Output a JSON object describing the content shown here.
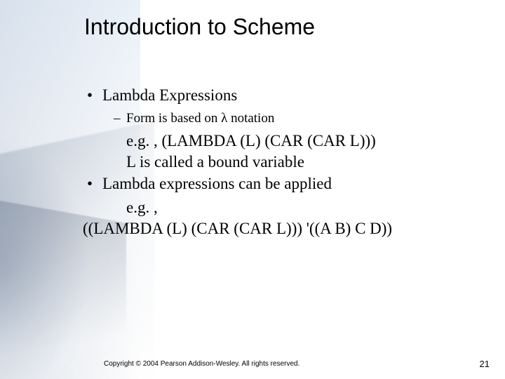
{
  "title": "Introduction to Scheme",
  "bullets": {
    "lambda_expr": "Lambda Expressions",
    "form_notation": "Form is based on λ notation",
    "eg1": "e.g. , (LAMBDA (L) (CAR (CAR L)))",
    "bound_var": "L is called a bound variable",
    "applied": "Lambda expressions can be applied",
    "eg2": "e.g. ,",
    "expr2": "((LAMBDA (L) (CAR (CAR L))) '((A B) C D))"
  },
  "footer": {
    "copyright": "Copyright © 2004 Pearson Addison-Wesley. All rights reserved.",
    "page": "21"
  }
}
